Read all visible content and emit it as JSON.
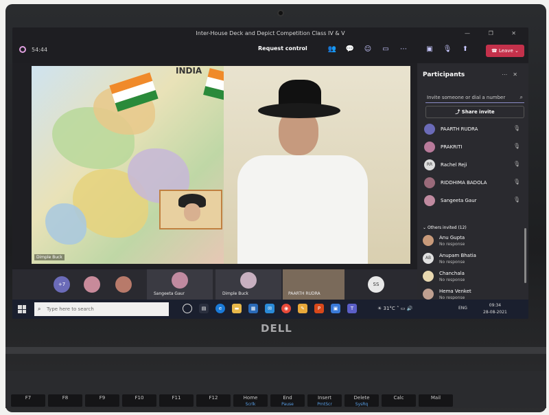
{
  "meeting": {
    "title": "Inter-House Deck and Depict Competition Class IV & V",
    "timer": "54:44",
    "request_control": "Request control",
    "leave_label": "Leave"
  },
  "video": {
    "map_label": "INDIA",
    "speaker_name": "Dimple Buck"
  },
  "gallery": {
    "overflow_count": "+7",
    "tiles": [
      {
        "name": "Sangeeta Gaur"
      },
      {
        "name": "Dimple Buck"
      },
      {
        "name": "PAARTH RUDRA"
      },
      {
        "initials": "SS"
      }
    ]
  },
  "participants": {
    "title": "Participants",
    "invite_placeholder": "Invite someone or dial a number",
    "share_invite": "Share invite",
    "items": [
      {
        "name": "PAARTH RUDRA",
        "initials": "",
        "color": "#6b6bb8"
      },
      {
        "name": "PRAKRITI",
        "initials": "",
        "color": "#b87a9a"
      },
      {
        "name": "Rachel Reji",
        "initials": "RR",
        "color": "#ddd"
      },
      {
        "name": "RIDDHIMA BADOLA",
        "initials": "",
        "color": "#9a6a7a"
      },
      {
        "name": "Sangeeta Gaur",
        "initials": "",
        "color": "#c08aa0"
      }
    ],
    "others_heading": "Others invited (12)",
    "others": [
      {
        "name": "Anu Gupta",
        "status": "No response",
        "initials": "",
        "color": "#c89a7a"
      },
      {
        "name": "Anupam Bhatia",
        "status": "No response",
        "initials": "AB",
        "color": "#e0e0e0"
      },
      {
        "name": "Chanchala",
        "status": "No response",
        "initials": "",
        "color": "#e8d8b0"
      },
      {
        "name": "Hema Venket",
        "status": "No response",
        "initials": "",
        "color": "#c0a090"
      }
    ]
  },
  "taskbar": {
    "search_placeholder": "Type here to search",
    "temperature": "31°C",
    "language": "ENG",
    "time": "09:34",
    "date": "28-08-2021"
  },
  "laptop": {
    "brand": "DELL",
    "fkeys": [
      {
        "label": "F7",
        "sub": ""
      },
      {
        "label": "F8",
        "sub": ""
      },
      {
        "label": "F9",
        "sub": ""
      },
      {
        "label": "F10",
        "sub": ""
      },
      {
        "label": "F11",
        "sub": ""
      },
      {
        "label": "F12",
        "sub": ""
      },
      {
        "label": "Home",
        "sub": "Scrlk"
      },
      {
        "label": "End",
        "sub": "Pause"
      },
      {
        "label": "Insert",
        "sub": "PrntScr"
      },
      {
        "label": "Delete",
        "sub": "SysRq"
      },
      {
        "label": "Calc",
        "sub": ""
      },
      {
        "label": "Mail",
        "sub": ""
      }
    ]
  }
}
